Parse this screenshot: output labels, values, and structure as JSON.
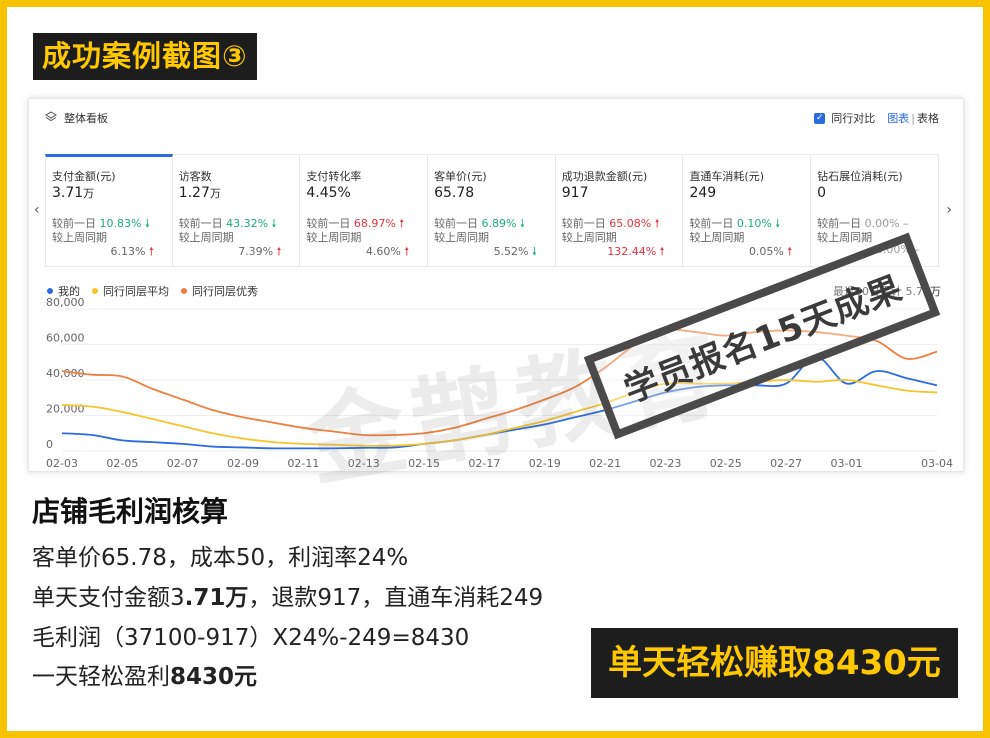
{
  "case_title": "成功案例截图③",
  "dashboard": {
    "title": "整体看板",
    "compare_label": "同行对比",
    "view_chart": "图表",
    "view_sep": "|",
    "view_table": "表格",
    "metrics": [
      {
        "label": "支付金额(元)",
        "value": "3.71",
        "unit": "万",
        "day_label": "较前一日",
        "day_pct": "10.83%",
        "day_dir": "down",
        "week_label": "较上周同期",
        "week_pct": "6.13%",
        "week_dir": "up"
      },
      {
        "label": "访客数",
        "value": "1.27",
        "unit": "万",
        "day_label": "较前一日",
        "day_pct": "43.32%",
        "day_dir": "down",
        "week_label": "较上周同期",
        "week_pct": "7.39%",
        "week_dir": "up"
      },
      {
        "label": "支付转化率",
        "value": "4.45%",
        "unit": "",
        "day_label": "较前一日",
        "day_pct": "68.97%",
        "day_dir": "up",
        "week_label": "较上周同期",
        "week_pct": "4.60%",
        "week_dir": "up"
      },
      {
        "label": "客单价(元)",
        "value": "65.78",
        "unit": "",
        "day_label": "较前一日",
        "day_pct": "6.89%",
        "day_dir": "down",
        "week_label": "较上周同期",
        "week_pct": "5.52%",
        "week_dir": "down"
      },
      {
        "label": "成功退款金额(元)",
        "value": "917",
        "unit": "",
        "day_label": "较前一日",
        "day_pct": "65.08%",
        "day_dir": "up",
        "week_label": "较上周同期",
        "week_pct": "132.44%",
        "week_dir": "up"
      },
      {
        "label": "直通车消耗(元)",
        "value": "249",
        "unit": "",
        "day_label": "较前一日",
        "day_pct": "0.10%",
        "day_dir": "down",
        "week_label": "较上周同期",
        "week_pct": "0.05%",
        "week_dir": "up"
      },
      {
        "label": "钻石展位消耗(元)",
        "value": "0",
        "unit": "",
        "day_label": "较前一日",
        "day_pct": "0.00%",
        "day_dir": "flat",
        "week_label": "较上周同期",
        "week_pct": "0.00%",
        "week_dir": "flat"
      }
    ],
    "arrow_symbols": {
      "up": "🠕",
      "down": "🠗",
      "flat": "–"
    },
    "legend": [
      {
        "name": "我的",
        "color": "#2b6be0"
      },
      {
        "name": "同行同层平均",
        "color": "#f5c52a"
      },
      {
        "name": "同行同层优秀",
        "color": "#f07f3c"
      }
    ],
    "range_note": "最近30日累计 5.79万",
    "nav_prev": "‹",
    "nav_next": "›"
  },
  "chart_data": {
    "type": "line",
    "x": [
      "02-03",
      "02-04",
      "02-05",
      "02-06",
      "02-07",
      "02-08",
      "02-09",
      "02-10",
      "02-11",
      "02-12",
      "02-13",
      "02-14",
      "02-15",
      "02-16",
      "02-17",
      "02-18",
      "02-19",
      "02-20",
      "02-21",
      "02-22",
      "02-23",
      "02-24",
      "02-25",
      "02-26",
      "02-27",
      "02-28",
      "03-01",
      "03-02",
      "03-03",
      "03-04"
    ],
    "xticks": [
      "02-03",
      "02-05",
      "02-07",
      "02-09",
      "02-11",
      "02-13",
      "02-15",
      "02-17",
      "02-19",
      "02-21",
      "02-23",
      "02-25",
      "02-27",
      "03-01",
      "03-04"
    ],
    "yticks": [
      "0",
      "20,000",
      "40,000",
      "60,000",
      "80,000"
    ],
    "ylim": [
      0,
      80000
    ],
    "series": [
      {
        "name": "我的",
        "color": "#2b6be0",
        "values": [
          10000,
          9000,
          6000,
          5000,
          4000,
          2500,
          2000,
          1500,
          1500,
          1500,
          1800,
          2000,
          4000,
          6000,
          9000,
          12000,
          15000,
          19000,
          23000,
          28000,
          33000,
          36000,
          37000,
          37000,
          38000,
          53000,
          38000,
          45000,
          41000,
          37000
        ]
      },
      {
        "name": "同行同层平均",
        "color": "#f5c52a",
        "values": [
          26000,
          25000,
          22000,
          18000,
          14000,
          10000,
          7000,
          5000,
          4000,
          3500,
          3000,
          3000,
          4000,
          6000,
          9000,
          13000,
          17000,
          22000,
          27000,
          33000,
          38000,
          38000,
          38000,
          39000,
          40000,
          39000,
          40000,
          37000,
          34000,
          33000
        ]
      },
      {
        "name": "同行同层优秀",
        "color": "#f07f3c",
        "values": [
          45000,
          43000,
          42000,
          35000,
          29000,
          23000,
          19000,
          16000,
          13000,
          11000,
          9000,
          9000,
          10000,
          13000,
          18000,
          23000,
          29000,
          36000,
          47000,
          60000,
          68000,
          67000,
          65000,
          67000,
          68000,
          67000,
          65000,
          62000,
          52000,
          56000
        ]
      }
    ]
  },
  "watermark": "金鹊教育",
  "stamp": "学员报名15天成果",
  "calc": {
    "title": "店铺毛利润核算",
    "line1": "客单价65.78，成本50，利润率24%",
    "line2_a": "单天支付金额3",
    "line2_b": ".71万",
    "line2_c": "，退款917，直通车消耗249",
    "line3": "毛利润（37100-917）X24%-249=8430",
    "line4_a": "一天轻松盈利",
    "line4_b": "8430元"
  },
  "badge": "单天轻松赚取8430元"
}
